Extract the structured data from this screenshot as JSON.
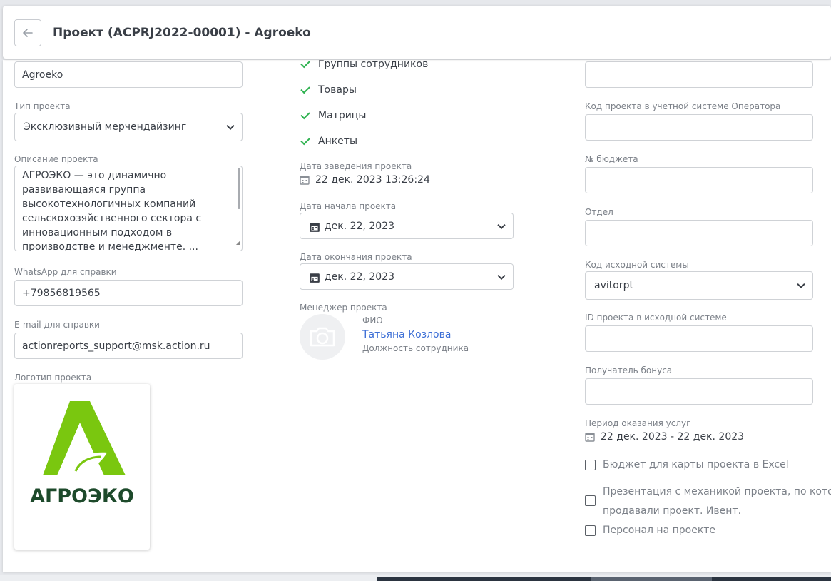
{
  "header": {
    "title": "Проект (ACPRJ2022-00001) - Agroeko"
  },
  "left": {
    "name_value": "Agroeko",
    "type_label": "Тип проекта",
    "type_value": "Эксклюзивный мерчендайзинг",
    "description_label": "Описание проекта",
    "description_value": "АГРОЭКО — это динамично развивающаяся группа высокотехнологичных компаний сельскохозяйственного сектора с инновационным подходом в производстве и менеджменте. ...",
    "whatsapp_label": "WhatsApp для справки",
    "whatsapp_value": "+79856819565",
    "email_label": "E-mail для справки",
    "email_value": "actionreports_support@msk.action.ru",
    "logo_label": "Логотип проекта",
    "logo_text": "АГРОЭКО"
  },
  "middle": {
    "checks": [
      "Группы сотрудников",
      "Товары",
      "Матрицы",
      "Анкеты"
    ],
    "created_label": "Дата заведения проекта",
    "created_value": "22 дек. 2023 13:26:24",
    "start_label": "Дата начала проекта",
    "start_value": "дек. 22, 2023",
    "end_label": "Дата окончания проекта",
    "end_value": "дек. 22, 2023",
    "manager_label": "Менеджер проекта",
    "manager_fio_label": "ФИО",
    "manager_name": "Татьяна Козлова",
    "manager_position": "Должность сотрудника"
  },
  "right": {
    "operator_code_label": "Код проекта в учетной системе Оператора",
    "budget_label": "№ бюджета",
    "department_label": "Отдел",
    "source_code_label": "Код исходной системы",
    "source_code_value": "avitorpt",
    "source_id_label": "ID проекта в исходной системе",
    "bonus_label": "Получатель бонуса",
    "period_label": "Период оказания услуг",
    "period_value": "22 дек. 2023 - 22 дек. 2023",
    "checkboxes": [
      "Бюджет для карты проекта в Excel",
      "Презентация с механикой проекта, по котор",
      "продавали проект. Ивент.",
      "Персонал на проекте"
    ]
  },
  "colors": {
    "check_green": "#2eb24f",
    "link_blue": "#3d6fd6",
    "logo_green": "#7ac70f",
    "logo_dark": "#1d4a2b"
  }
}
